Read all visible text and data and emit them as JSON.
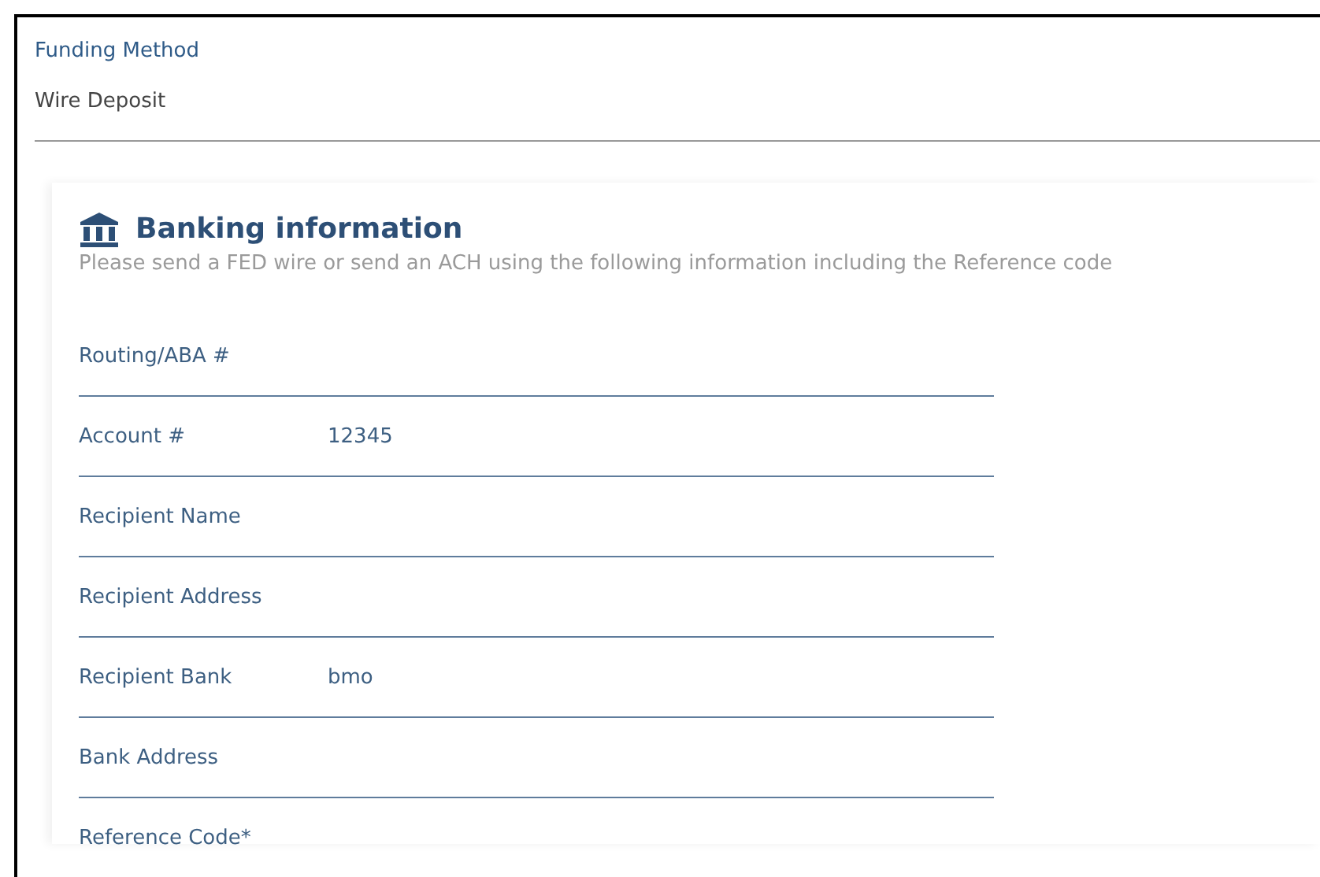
{
  "funding_method": {
    "label": "Funding Method",
    "value": "Wire Deposit"
  },
  "banking_card": {
    "title": "Banking information",
    "subtitle": "Please send a FED wire or send an ACH using the following information including the Reference code",
    "rows": [
      {
        "label": "Routing/ABA #"
      },
      {
        "label": "Account #",
        "value": "12345"
      },
      {
        "label": "Recipient Name"
      },
      {
        "label": "Recipient Address"
      },
      {
        "label": "Recipient Bank",
        "value": "bmo"
      },
      {
        "label": "Bank Address"
      },
      {
        "label": "Reference Code*"
      }
    ]
  }
}
